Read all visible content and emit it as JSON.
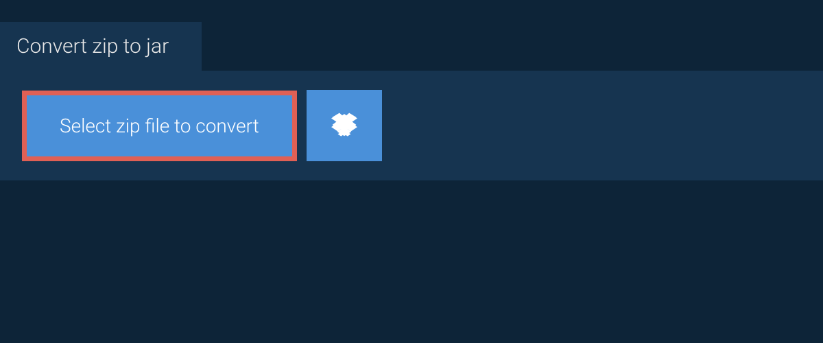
{
  "header": {
    "tab_label": "Convert zip to jar"
  },
  "actions": {
    "select_file_label": "Select zip file to convert",
    "cloud_source_icon": "dropbox-icon"
  },
  "colors": {
    "page_bg": "#0d2438",
    "panel_bg": "#163450",
    "button_bg": "#4a90d9",
    "highlight_border": "#e06055",
    "text_light": "#e8e8e8",
    "text_white": "#ffffff"
  }
}
